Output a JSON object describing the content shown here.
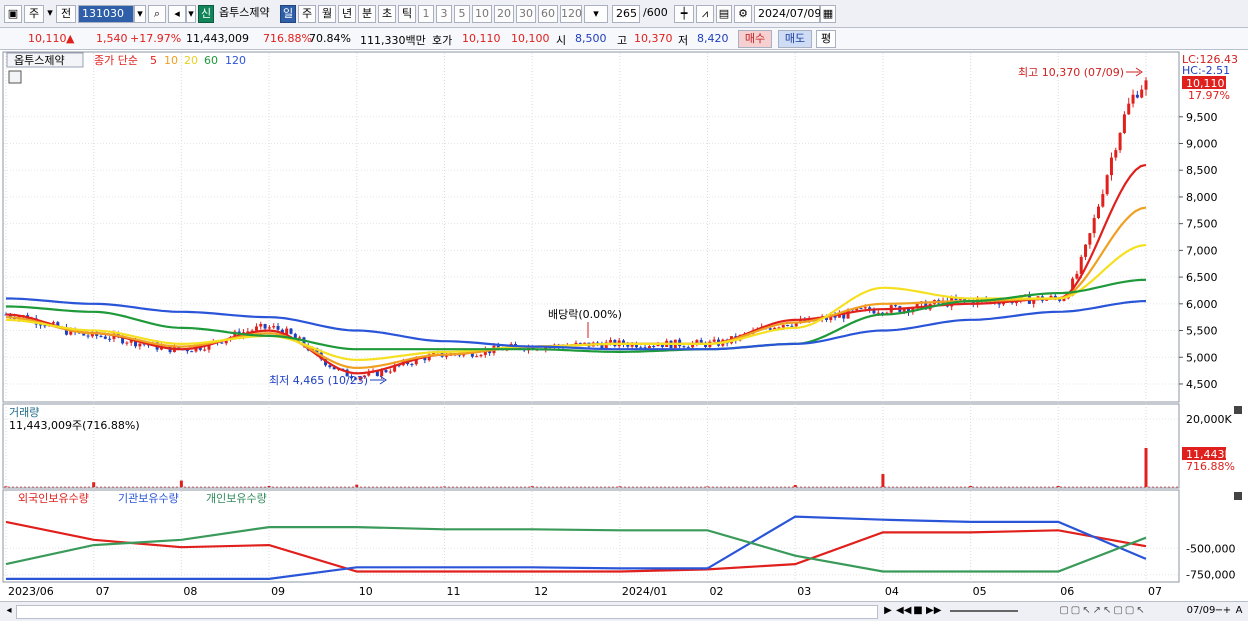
{
  "toolbar": {
    "market_type": "주",
    "prev_label": "전",
    "code": "131030",
    "badge_new": "신",
    "stock_name": "옵투스제약",
    "periods": [
      "일",
      "주",
      "월",
      "년",
      "분",
      "초",
      "틱"
    ],
    "minutes": [
      "1",
      "3",
      "5",
      "10",
      "20",
      "30",
      "60",
      "120"
    ],
    "count": "265",
    "count_total": "/600",
    "date": "2024/07/09"
  },
  "quote": {
    "price": "10,110",
    "change": "1,540",
    "change_pct": "+17.97%",
    "volume": "11,443,009",
    "volume_ratio": "716.88%",
    "turnover": "70.84%",
    "amount": "111,330백만",
    "bid_label": "호가",
    "ask": "10,110",
    "bid": "10,100",
    "open_label": "시",
    "open": "8,500",
    "high_label": "고",
    "high": "10,370",
    "low_label": "저",
    "low": "8,420",
    "buy_label": "매수",
    "sell_label": "매도",
    "flat_label": "평"
  },
  "legend": {
    "stock_name": "옵투스제약",
    "price_ma_label": "종가 단순",
    "ma_labels": [
      "5",
      "10",
      "20",
      "60",
      "120"
    ],
    "volume_title": "거래량",
    "volume_value": "11,443,009주(716.88%)",
    "holding_labels": [
      "외국인보유수량",
      "기관보유수량",
      "개인보유수량"
    ]
  },
  "annotations": {
    "high_note": "최고 10,370 (07/09)",
    "low_note": "최저 4,465 (10/23)",
    "dividend_note": "배당락(0.00%)",
    "lc": "LC:126.43",
    "hc": "HC:-2.51",
    "price_tag": "10,110",
    "pct_tag": "17.97%",
    "vol_tag": "11,443K",
    "vol_pct_tag": "716.88%"
  },
  "colors": {
    "up": "#e0201c",
    "down": "#1f3fbf",
    "ma5": "#e0201c",
    "ma10": "#f0a020",
    "ma20": "#f5e020",
    "ma60": "#1e9a3a",
    "ma120": "#2a55d8",
    "foreign": "#e0201c",
    "institution": "#2a55d8",
    "individual": "#3a9a5a"
  },
  "chart_data": [
    {
      "type": "line",
      "title": "",
      "x": [
        "2023/06",
        "07",
        "08",
        "09",
        "10",
        "11",
        "12",
        "2024/01",
        "02",
        "03",
        "04",
        "05",
        "06",
        "07"
      ],
      "ylim": [
        4200,
        10600
      ],
      "yticks": [
        "4,500",
        "5,000",
        "5,500",
        "6,000",
        "6,500",
        "7,000",
        "7,500",
        "8,000",
        "8,500",
        "9,000",
        "9,500"
      ],
      "series": [
        {
          "name": "종가",
          "values": [
            5800,
            5400,
            5150,
            5550,
            4650,
            5050,
            5200,
            5250,
            5250,
            5650,
            5900,
            6050,
            6100,
            10110
          ]
        },
        {
          "name": "5",
          "values": [
            5800,
            5450,
            5150,
            5500,
            4700,
            5050,
            5200,
            5250,
            5250,
            5700,
            5900,
            6000,
            6100,
            8600
          ]
        },
        {
          "name": "10",
          "values": [
            5750,
            5450,
            5200,
            5450,
            4800,
            5050,
            5200,
            5250,
            5250,
            5650,
            6000,
            6050,
            6100,
            7800
          ]
        },
        {
          "name": "20",
          "values": [
            5700,
            5500,
            5250,
            5400,
            4950,
            5100,
            5200,
            5250,
            5250,
            5550,
            6300,
            6100,
            6100,
            7100
          ]
        },
        {
          "name": "60",
          "values": [
            5950,
            5850,
            5550,
            5400,
            5150,
            5150,
            5150,
            5100,
            5150,
            5250,
            5800,
            6050,
            6200,
            6450
          ]
        },
        {
          "name": "120",
          "values": [
            6100,
            6000,
            5850,
            5750,
            5500,
            5300,
            5200,
            5150,
            5150,
            5250,
            5500,
            5700,
            5850,
            6050
          ]
        }
      ]
    },
    {
      "type": "bar",
      "title": "거래량",
      "categories": [
        "2023/06",
        "07",
        "08",
        "09",
        "10",
        "11",
        "12",
        "2024/01",
        "02",
        "03",
        "04",
        "05",
        "06",
        "07"
      ],
      "ylim": [
        0,
        22000
      ],
      "yticks": [
        "20,000K"
      ],
      "values": [
        200,
        1400,
        1900,
        300,
        700,
        150,
        250,
        200,
        150,
        600,
        3800,
        300,
        300,
        11443
      ]
    },
    {
      "type": "line",
      "title": "외국인보유수량 기관보유수량 개인보유수량",
      "x": [
        "2023/06",
        "07",
        "08",
        "09",
        "10",
        "11",
        "12",
        "2024/01",
        "02",
        "03",
        "04",
        "05",
        "06",
        "07"
      ],
      "ylim": [
        -800000,
        -100000
      ],
      "yticks": [
        "-500,000",
        "-750,000"
      ],
      "series": [
        {
          "name": "외국인보유수량",
          "values": [
            -250000,
            -420000,
            -490000,
            -470000,
            -720000,
            -720000,
            -720000,
            -720000,
            -700000,
            -650000,
            -350000,
            -350000,
            -330000,
            -480000
          ]
        },
        {
          "name": "기관보유수량",
          "values": [
            -790000,
            -790000,
            -790000,
            -790000,
            -680000,
            -680000,
            -680000,
            -690000,
            -690000,
            -200000,
            -230000,
            -250000,
            -250000,
            -600000
          ]
        },
        {
          "name": "개인보유수량",
          "values": [
            -650000,
            -470000,
            -420000,
            -300000,
            -300000,
            -320000,
            -320000,
            -330000,
            -330000,
            -570000,
            -720000,
            -720000,
            -720000,
            -400000
          ]
        }
      ]
    }
  ],
  "status": {
    "ticks": [
      "▶",
      "◀◀",
      "■",
      "▶▶",
      "+",
      "−",
      "A"
    ],
    "right_date": "07/09"
  }
}
